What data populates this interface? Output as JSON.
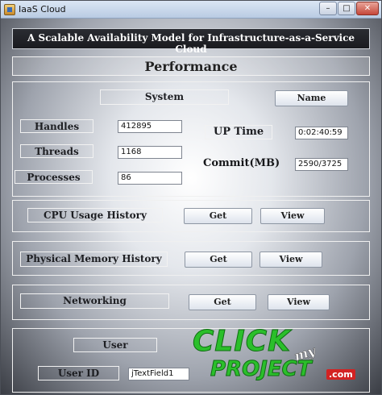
{
  "window": {
    "title": "IaaS Cloud",
    "min": "–",
    "max": "□",
    "close": "✕"
  },
  "header": {
    "title": "A Scalable Availability Model for Infrastructure-as-a-Service Cloud"
  },
  "performance": {
    "title": "Performance"
  },
  "system": {
    "label": "System",
    "name_button": "Name",
    "handles_label": "Handles",
    "handles_value": "412895",
    "threads_label": "Threads",
    "threads_value": "1168",
    "processes_label": "Processes",
    "processes_value": "86",
    "uptime_label": "UP Time",
    "uptime_value": "0:02:40:59",
    "commit_label": "Commit(MB)",
    "commit_value": "2590/3725"
  },
  "cpu": {
    "label": "CPU Usage History",
    "get": "Get",
    "view": "View"
  },
  "memory": {
    "label": "Physical Memory History",
    "get": "Get",
    "view": "View"
  },
  "networking": {
    "label": "Networking",
    "get": "Get",
    "view": "View"
  },
  "user": {
    "label": "User",
    "userid_label": "User ID",
    "userid_value": "jTextField1"
  },
  "logo": {
    "click": "CLICK",
    "my": "my",
    "project": "PROJECT",
    "com": ".com"
  }
}
